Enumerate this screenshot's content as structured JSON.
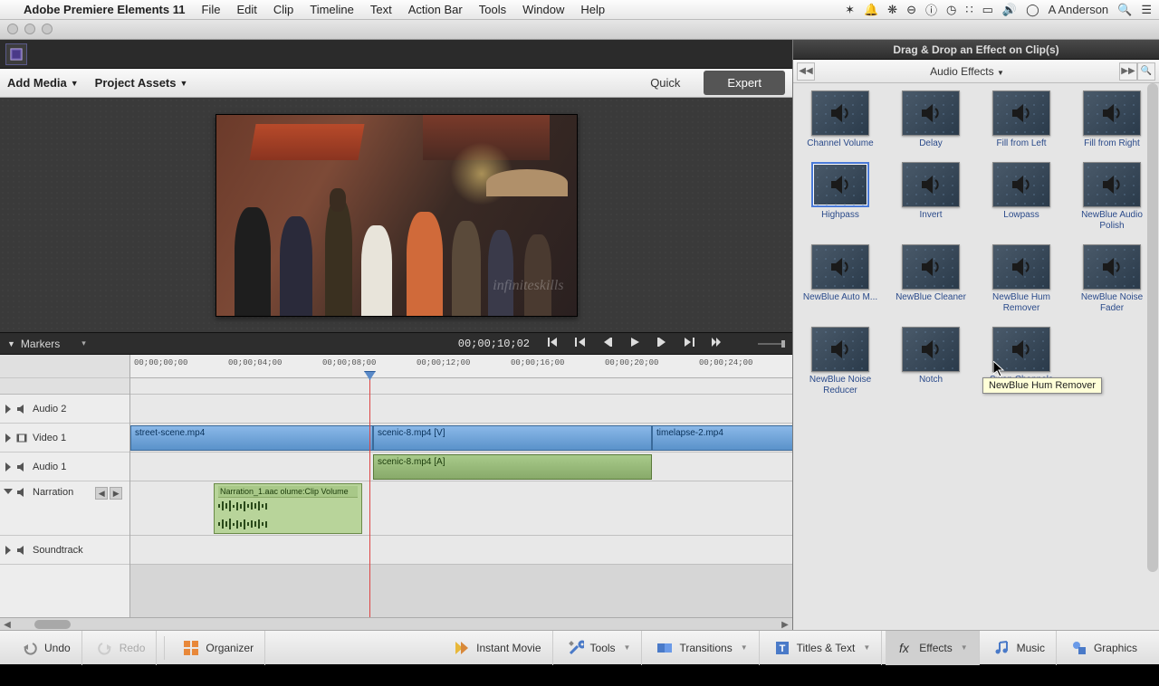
{
  "menubar": {
    "app": "Adobe Premiere Elements 11",
    "items": [
      "File",
      "Edit",
      "Clip",
      "Timeline",
      "Text",
      "Action Bar",
      "Tools",
      "Window",
      "Help"
    ],
    "user": "A Anderson"
  },
  "toolbar": {
    "add_media": "Add Media",
    "project_assets": "Project Assets",
    "mode_quick": "Quick",
    "mode_expert": "Expert"
  },
  "monitor": {
    "watermark": "infiniteskills"
  },
  "markers_label": "Markers",
  "timecode": "00;00;10;02",
  "ruler_ticks": [
    "00;00;00;00",
    "00;00;04;00",
    "00;00;08;00",
    "00;00;12;00",
    "00;00;16;00",
    "00;00;20;00",
    "00;00;24;00"
  ],
  "tracks": {
    "audio2": "Audio 2",
    "video1": "Video 1",
    "audio1": "Audio 1",
    "narration": "Narration",
    "soundtrack": "Soundtrack"
  },
  "clips": {
    "street": "street-scene.mp4",
    "scenic_v": "scenic-8.mp4 [V]",
    "scenic_a": "scenic-8.mp4 [A]",
    "timelapse": "timelapse-2.mp4",
    "narration": "Narration_1.aac olume:Clip Volume"
  },
  "bottom": {
    "undo": "Undo",
    "redo": "Redo",
    "organizer": "Organizer",
    "instant_movie": "Instant Movie",
    "tools": "Tools",
    "transitions": "Transitions",
    "titles": "Titles & Text",
    "effects": "Effects",
    "music": "Music",
    "graphics": "Graphics"
  },
  "fx_panel": {
    "title": "Drag & Drop an Effect on Clip(s)",
    "category": "Audio Effects",
    "items": [
      "Channel Volume",
      "Delay",
      "Fill from Left",
      "Fill from Right",
      "Highpass",
      "Invert",
      "Lowpass",
      "NewBlue Audio Polish",
      "NewBlue Auto M...",
      "NewBlue Cleaner",
      "NewBlue Hum Remover",
      "NewBlue Noise Fader",
      "NewBlue Noise Reducer",
      "Notch",
      "Swap Channels"
    ],
    "selected_index": 4,
    "tooltip": "NewBlue Hum Remover"
  }
}
